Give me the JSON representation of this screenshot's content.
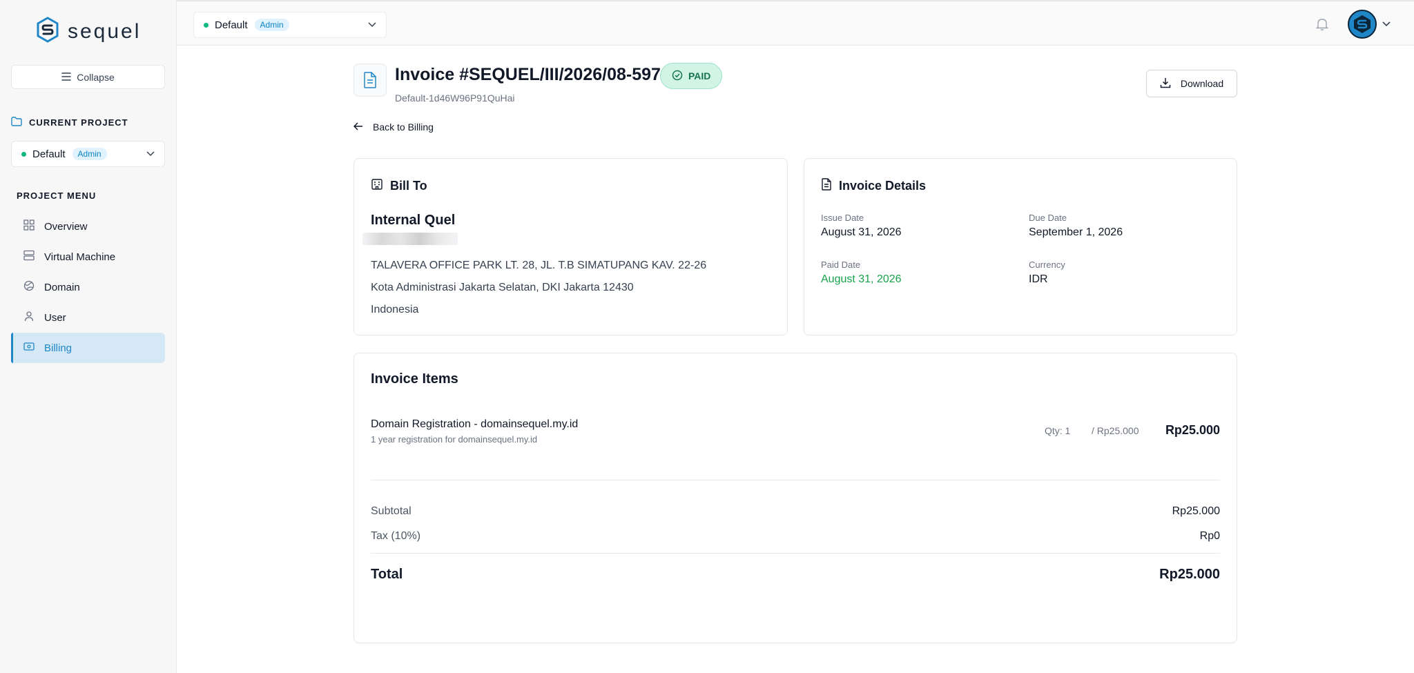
{
  "brand": {
    "name": "sequel",
    "accent": "#1f86c7"
  },
  "sidebar": {
    "collapse_label": "Collapse",
    "current_project_heading": "CURRENT PROJECT",
    "project": {
      "name": "Default",
      "role": "Admin"
    },
    "menu_heading": "PROJECT MENU",
    "items": [
      {
        "label": "Overview",
        "icon": "grid-icon"
      },
      {
        "label": "Virtual Machine",
        "icon": "server-icon"
      },
      {
        "label": "Domain",
        "icon": "globe-icon"
      },
      {
        "label": "User",
        "icon": "user-icon"
      },
      {
        "label": "Billing",
        "icon": "billing-icon",
        "active": true
      }
    ]
  },
  "topbar": {
    "project": {
      "name": "Default",
      "role": "Admin"
    }
  },
  "invoice": {
    "title": "Invoice #SEQUEL/III/2026/08-597",
    "status": "PAID",
    "subtitle": "Default-1d46W96P91QuHai",
    "download_label": "Download",
    "back_label": "Back to Billing"
  },
  "bill_to": {
    "heading": "Bill To",
    "company": "Internal Quel",
    "address_line1": "TALAVERA OFFICE PARK LT. 28, JL. T.B SIMATUPANG KAV. 22-26",
    "address_line2": "Kota Administrasi Jakarta Selatan, DKI Jakarta 12430",
    "country": "Indonesia"
  },
  "details": {
    "heading": "Invoice Details",
    "issue_label": "Issue Date",
    "issue_value": "August 31, 2026",
    "due_label": "Due Date",
    "due_value": "September 1, 2026",
    "paid_label": "Paid Date",
    "paid_value": "August 31, 2026",
    "currency_label": "Currency",
    "currency_value": "IDR"
  },
  "items": {
    "heading": "Invoice Items",
    "rows": [
      {
        "name": "Domain Registration - domainsequel.my.id",
        "description": "1 year registration for domainsequel.my.id",
        "qty": "Qty: 1",
        "unit_price": "/ Rp25.000",
        "total": "Rp25.000"
      }
    ],
    "subtotal_label": "Subtotal",
    "subtotal_value": "Rp25.000",
    "tax_label": "Tax (10%)",
    "tax_value": "Rp0",
    "total_label": "Total",
    "total_value": "Rp25.000"
  }
}
